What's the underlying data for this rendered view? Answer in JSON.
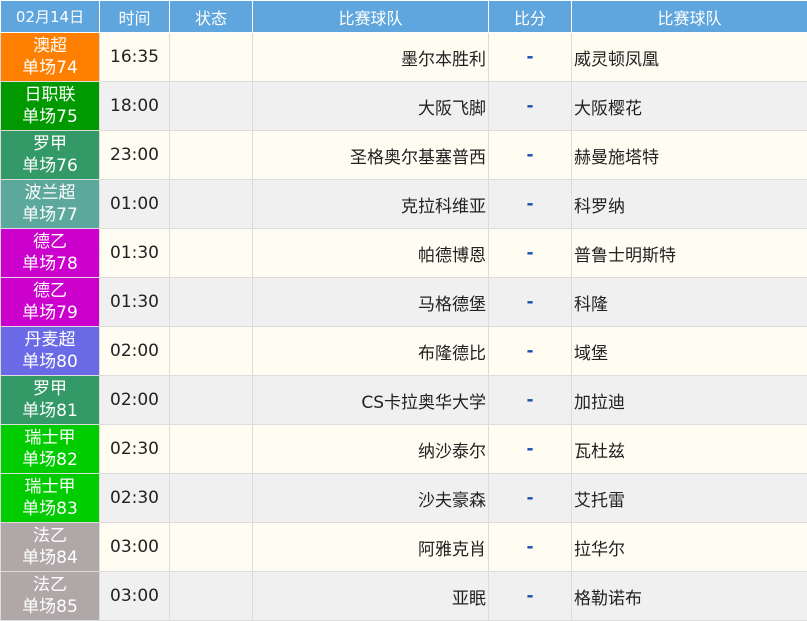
{
  "header": {
    "date": "02月14日",
    "time": "时间",
    "status": "状态",
    "home_team": "比赛球队",
    "score": "比分",
    "away_team": "比赛球队"
  },
  "matches": [
    {
      "league": "澳超",
      "match_no": "单场74",
      "league_color": "#ff7f00",
      "time": "16:35",
      "status": "",
      "home": "墨尔本胜利",
      "score": "-",
      "away": "威灵顿凤凰"
    },
    {
      "league": "日职联",
      "match_no": "单场75",
      "league_color": "#009900",
      "time": "18:00",
      "status": "",
      "home": "大阪飞脚",
      "score": "-",
      "away": "大阪樱花"
    },
    {
      "league": "罗甲",
      "match_no": "单场76",
      "league_color": "#339966",
      "time": "23:00",
      "status": "",
      "home": "圣格奥尔基塞普西",
      "score": "-",
      "away": "赫曼施塔特"
    },
    {
      "league": "波兰超",
      "match_no": "单场77",
      "league_color": "#5ca89c",
      "time": "01:00",
      "status": "",
      "home": "克拉科维亚",
      "score": "-",
      "away": "科罗纳"
    },
    {
      "league": "德乙",
      "match_no": "单场78",
      "league_color": "#cc00cc",
      "time": "01:30",
      "status": "",
      "home": "帕德博恩",
      "score": "-",
      "away": "普鲁士明斯特"
    },
    {
      "league": "德乙",
      "match_no": "单场79",
      "league_color": "#cc00cc",
      "time": "01:30",
      "status": "",
      "home": "马格德堡",
      "score": "-",
      "away": "科隆"
    },
    {
      "league": "丹麦超",
      "match_no": "单场80",
      "league_color": "#6a6ae6",
      "time": "02:00",
      "status": "",
      "home": "布隆德比",
      "score": "-",
      "away": "域堡"
    },
    {
      "league": "罗甲",
      "match_no": "单场81",
      "league_color": "#339966",
      "time": "02:00",
      "status": "",
      "home": "CS卡拉奥华大学",
      "score": "-",
      "away": "加拉迪"
    },
    {
      "league": "瑞士甲",
      "match_no": "单场82",
      "league_color": "#00cc00",
      "time": "02:30",
      "status": "",
      "home": "纳沙泰尔",
      "score": "-",
      "away": "瓦杜兹"
    },
    {
      "league": "瑞士甲",
      "match_no": "单场83",
      "league_color": "#00cc00",
      "time": "02:30",
      "status": "",
      "home": "沙夫豪森",
      "score": "-",
      "away": "艾托雷"
    },
    {
      "league": "法乙",
      "match_no": "单场84",
      "league_color": "#b0a8a8",
      "time": "03:00",
      "status": "",
      "home": "阿雅克肖",
      "score": "-",
      "away": "拉华尔"
    },
    {
      "league": "法乙",
      "match_no": "单场85",
      "league_color": "#b0a8a8",
      "time": "03:00",
      "status": "",
      "home": "亚眠",
      "score": "-",
      "away": "格勒诺布"
    }
  ]
}
